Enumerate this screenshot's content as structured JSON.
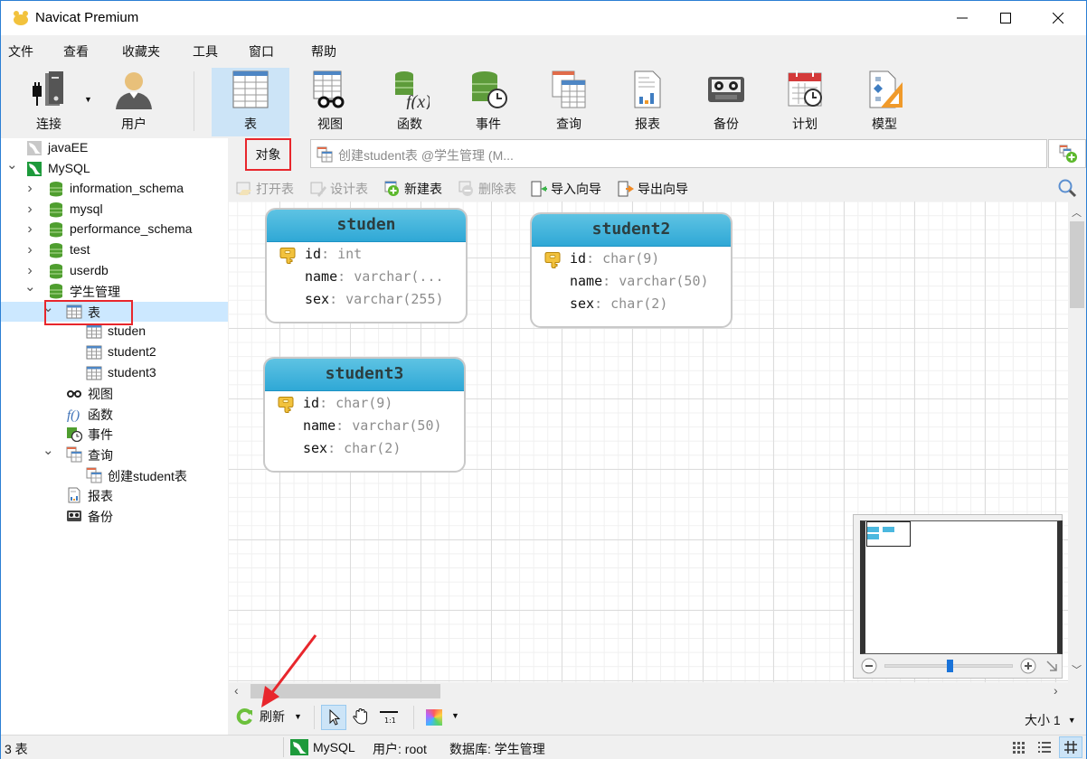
{
  "window": {
    "title": "Navicat Premium",
    "controls": {
      "minimize": "minimize",
      "maximize": "maximize",
      "close": "close"
    }
  },
  "menu": [
    "文件",
    "查看",
    "收藏夹",
    "工具",
    "窗口",
    "帮助"
  ],
  "toolbar": {
    "buttons": [
      {
        "label": "连接",
        "icon": "connection-icon"
      },
      {
        "label": "用户",
        "icon": "user-icon"
      },
      {
        "label": "表",
        "icon": "table-icon",
        "active": true
      },
      {
        "label": "视图",
        "icon": "view-icon"
      },
      {
        "label": "函数",
        "icon": "function-icon"
      },
      {
        "label": "事件",
        "icon": "event-icon"
      },
      {
        "label": "查询",
        "icon": "query-icon"
      },
      {
        "label": "报表",
        "icon": "report-icon"
      },
      {
        "label": "备份",
        "icon": "backup-icon"
      },
      {
        "label": "计划",
        "icon": "schedule-icon"
      },
      {
        "label": "模型",
        "icon": "model-icon"
      }
    ]
  },
  "sidebar": {
    "tree": [
      {
        "label": "javaEE",
        "icon": "connection-gray-icon",
        "level": 0,
        "expand": "none"
      },
      {
        "label": "MySQL",
        "icon": "mysql-icon",
        "level": 0,
        "expand": "open"
      },
      {
        "label": "information_schema",
        "icon": "database-icon",
        "level": 1,
        "expand": "closed"
      },
      {
        "label": "mysql",
        "icon": "database-icon",
        "level": 1,
        "expand": "closed"
      },
      {
        "label": "performance_schema",
        "icon": "database-icon",
        "level": 1,
        "expand": "closed"
      },
      {
        "label": "test",
        "icon": "database-icon",
        "level": 1,
        "expand": "closed"
      },
      {
        "label": "userdb",
        "icon": "database-icon",
        "level": 1,
        "expand": "closed"
      },
      {
        "label": "学生管理",
        "icon": "database-icon",
        "level": 1,
        "expand": "open"
      },
      {
        "label": "表",
        "icon": "table-icon",
        "level": 2,
        "expand": "open",
        "selected": true
      },
      {
        "label": "studen",
        "icon": "table-icon",
        "level": 3,
        "expand": "none"
      },
      {
        "label": "student2",
        "icon": "table-icon",
        "level": 3,
        "expand": "none"
      },
      {
        "label": "student3",
        "icon": "table-icon",
        "level": 3,
        "expand": "none"
      },
      {
        "label": "视图",
        "icon": "view-icon",
        "level": 2,
        "expand": "none"
      },
      {
        "label": "函数",
        "icon": "function-icon",
        "level": 2,
        "expand": "none"
      },
      {
        "label": "事件",
        "icon": "event-icon",
        "level": 2,
        "expand": "none"
      },
      {
        "label": "查询",
        "icon": "query-icon",
        "level": 2,
        "expand": "open"
      },
      {
        "label": "创建student表",
        "icon": "query-icon",
        "level": 3,
        "expand": "none"
      },
      {
        "label": "报表",
        "icon": "report-icon",
        "level": 2,
        "expand": "none"
      },
      {
        "label": "备份",
        "icon": "backup-icon",
        "level": 2,
        "expand": "none"
      }
    ]
  },
  "tabs": {
    "objects_label": "对象",
    "query_tab": "创建student表 @学生管理 (M..."
  },
  "object_toolbar": [
    {
      "label": "打开表",
      "enabled": false,
      "icon": "open-table-icon"
    },
    {
      "label": "设计表",
      "enabled": false,
      "icon": "design-table-icon"
    },
    {
      "label": "新建表",
      "enabled": true,
      "icon": "new-table-icon"
    },
    {
      "label": "删除表",
      "enabled": false,
      "icon": "delete-table-icon"
    },
    {
      "label": "导入向导",
      "enabled": true,
      "icon": "import-wizard-icon"
    },
    {
      "label": "导出向导",
      "enabled": true,
      "icon": "export-wizard-icon"
    }
  ],
  "entities": [
    {
      "name": "studen",
      "fields": [
        {
          "name": "id",
          "type": "int",
          "pk": true
        },
        {
          "name": "name",
          "type": "varchar(...",
          "pk": false
        },
        {
          "name": "sex",
          "type": "varchar(255)",
          "pk": false
        }
      ]
    },
    {
      "name": "student2",
      "fields": [
        {
          "name": "id",
          "type": "char(9)",
          "pk": true
        },
        {
          "name": "name",
          "type": "varchar(50)",
          "pk": false
        },
        {
          "name": "sex",
          "type": "char(2)",
          "pk": false
        }
      ]
    },
    {
      "name": "student3",
      "fields": [
        {
          "name": "id",
          "type": "char(9)",
          "pk": true
        },
        {
          "name": "name",
          "type": "varchar(50)",
          "pk": false
        },
        {
          "name": "sex",
          "type": "char(2)",
          "pk": false
        }
      ]
    }
  ],
  "minimap": {
    "zoom_fraction": 0.5
  },
  "bottom_toolbar": {
    "refresh_label": "刷新",
    "size_label": "大小 1"
  },
  "status": {
    "count": "3 表",
    "connection": "MySQL",
    "user": "用户: root",
    "database": "数据库: 学生管理"
  },
  "colors": {
    "accent": "#cce4f7",
    "entity_header": "#3fb3de",
    "highlight_box": "#e8262c",
    "selection": "#cce8ff"
  }
}
